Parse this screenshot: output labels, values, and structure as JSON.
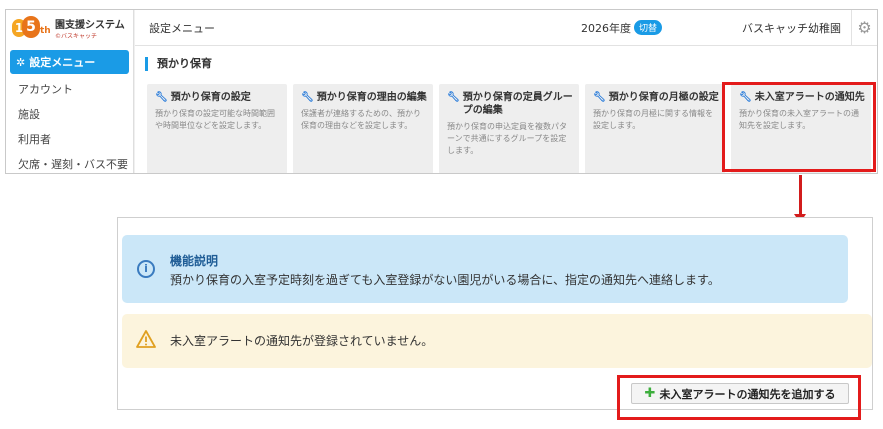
{
  "logo": {
    "mark_digits_1": "1",
    "mark_digits_5": "5",
    "mark_suffix": "th",
    "title": "園支援システム",
    "subtitle": "©バスキャッチ"
  },
  "sidebar": {
    "active_item": "設定メニュー",
    "active_icon": "gear-icon",
    "items": [
      {
        "label": "アカウント"
      },
      {
        "label": "施設"
      },
      {
        "label": "利用者"
      },
      {
        "label": "欠席・遅刻・バス不要"
      }
    ]
  },
  "header": {
    "title": "設定メニュー",
    "year": "2026年度",
    "switch_label": "切替",
    "school": "バスキャッチ幼稚園",
    "settings_icon": "gear-icon"
  },
  "section": {
    "title": "預かり保育"
  },
  "cards": [
    {
      "title": "預かり保育の設定",
      "description": "預かり保育の設定可能な時間範囲や時間単位などを設定します。",
      "icon": "wrench-icon"
    },
    {
      "title": "預かり保育の理由の編集",
      "description": "保護者が連絡するための、預かり保育の理由などを設定します。",
      "icon": "wrench-icon"
    },
    {
      "title": "預かり保育の定員グループの編集",
      "description": "預かり保育の申込定員を複数パターンで共通にするグループを設定します。",
      "icon": "wrench-icon"
    },
    {
      "title": "預かり保育の月極の設定",
      "description": "預かり保育の月極に関する情報を設定します。",
      "icon": "wrench-icon"
    },
    {
      "title": "未入室アラートの通知先",
      "description": "預かり保育の未入室アラートの通知先を設定します。",
      "icon": "wrench-icon"
    }
  ],
  "info": {
    "icon": "info-icon",
    "title": "機能説明",
    "text": "預かり保育の入室予定時刻を過ぎても入室登録がない園児がいる場合に、指定の通知先へ連絡します。"
  },
  "warning": {
    "icon": "warning-icon",
    "text": "未入室アラートの通知先が登録されていません。"
  },
  "add_button": {
    "icon": "plus-icon",
    "label": "未入室アラートの通知先を追加する"
  },
  "colors": {
    "accent": "#1a9be6",
    "highlight": "#e31b1b",
    "info_bg": "#cbe7f8",
    "warning_bg": "#fcf4dd"
  }
}
